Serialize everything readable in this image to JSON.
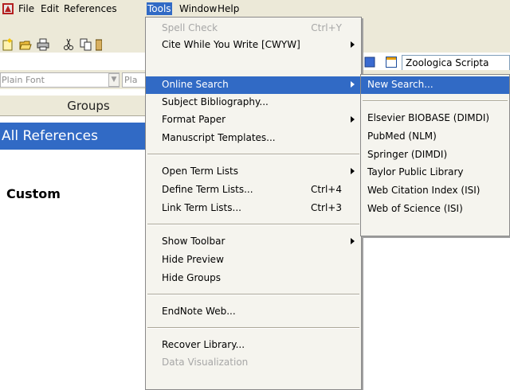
{
  "menubar": {
    "items": [
      "File",
      "Edit",
      "References",
      "Tools",
      "Window",
      "Help"
    ],
    "active": "Tools"
  },
  "toolbar": {
    "output_style": "Zoologica Scripta"
  },
  "format_bar": {
    "font_value": "Plain Font",
    "size_value": "Pla"
  },
  "groups": {
    "header": "Groups",
    "all_references": "All References",
    "custom_label": "Custom"
  },
  "tools_menu": {
    "items": [
      {
        "label": "Spell Check",
        "shortcut": "Ctrl+Y",
        "disabled": true
      },
      {
        "label": "Cite While You Write [CWYW]",
        "submenu": true
      },
      {
        "label": "Online Search",
        "submenu": true,
        "highlighted": true
      },
      {
        "label": "Subject Bibliography..."
      },
      {
        "label": "Format Paper",
        "submenu": true
      },
      {
        "label": "Manuscript Templates..."
      },
      {
        "label": "Open Term Lists",
        "submenu": true
      },
      {
        "label": "Define Term Lists...",
        "shortcut": "Ctrl+4"
      },
      {
        "label": "Link Term Lists...",
        "shortcut": "Ctrl+3"
      },
      {
        "label": "Show Toolbar",
        "submenu": true
      },
      {
        "label": "Hide Preview"
      },
      {
        "label": "Hide Groups"
      },
      {
        "label": "EndNote Web..."
      },
      {
        "label": "Recover Library..."
      },
      {
        "label": "Data Visualization",
        "disabled": true
      }
    ]
  },
  "online_search_submenu": {
    "items": [
      {
        "label": "New Search...",
        "highlighted": true
      },
      {
        "label": "Elsevier BIOBASE (DIMDI)"
      },
      {
        "label": "PubMed (NLM)"
      },
      {
        "label": "Springer (DIMDI)"
      },
      {
        "label": "Taylor Public Library"
      },
      {
        "label": "Web Citation Index (ISI)"
      },
      {
        "label": "Web of Science (ISI)"
      }
    ]
  },
  "colors": {
    "highlight": "#316ac5",
    "chrome": "#ece9d8",
    "menu_bg": "#f5f4ee"
  }
}
